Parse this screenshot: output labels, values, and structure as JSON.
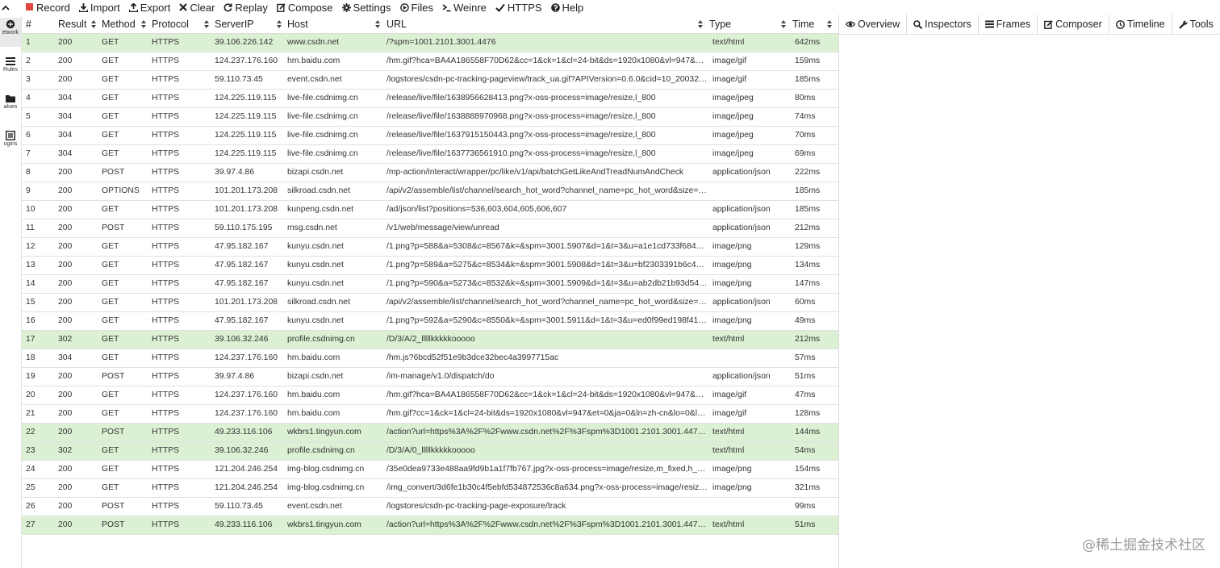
{
  "toolbar": {
    "items": [
      {
        "label": "Record",
        "icon": "record-icon"
      },
      {
        "label": "Import",
        "icon": "import-icon"
      },
      {
        "label": "Export",
        "icon": "export-icon"
      },
      {
        "label": "Clear",
        "icon": "clear-icon"
      },
      {
        "label": "Replay",
        "icon": "replay-icon"
      },
      {
        "label": "Compose",
        "icon": "compose-icon"
      },
      {
        "label": "Settings",
        "icon": "gear-icon"
      },
      {
        "label": "Files",
        "icon": "files-icon"
      },
      {
        "label": "Weinre",
        "icon": "terminal-icon"
      },
      {
        "label": "HTTPS",
        "icon": "check-icon"
      },
      {
        "label": "Help",
        "icon": "help-icon"
      }
    ]
  },
  "rail": {
    "items": [
      {
        "label": "etwork",
        "icon": "network-icon"
      },
      {
        "label": "Rules",
        "icon": "rules-icon"
      },
      {
        "label": "alues",
        "icon": "values-icon"
      },
      {
        "label": "ugins",
        "icon": "plugins-icon"
      }
    ]
  },
  "grid": {
    "columns": {
      "num": "#",
      "result": "Result",
      "method": "Method",
      "protocol": "Protocol",
      "serverip": "ServerIP",
      "host": "Host",
      "url": "URL",
      "type": "Type",
      "time": "Time"
    },
    "rows": [
      {
        "num": "1",
        "result": "200",
        "method": "GET",
        "protocol": "HTTPS",
        "ip": "39.106.226.142",
        "host": "www.csdn.net",
        "url": "/?spm=1001.2101.3001.4476",
        "type": "text/html",
        "time": "642ms",
        "green": true
      },
      {
        "num": "2",
        "result": "200",
        "method": "GET",
        "protocol": "HTTPS",
        "ip": "124.237.176.160",
        "host": "hm.baidu.com",
        "url": "/hm.gif?hca=BA4A186558F70D62&cc=1&ck=1&cl=24-bit&ds=1920x1080&vl=947&ep=9…",
        "type": "image/gif",
        "time": "159ms",
        "green": false
      },
      {
        "num": "3",
        "result": "200",
        "method": "GET",
        "protocol": "HTTPS",
        "ip": "59.110.73.45",
        "host": "event.csdn.net",
        "url": "/logstores/csdn-pc-tracking-pageview/track_ua.gif?APIVersion=0.6.0&cid=10_200327090…",
        "type": "image/gif",
        "time": "185ms",
        "green": false
      },
      {
        "num": "4",
        "result": "304",
        "method": "GET",
        "protocol": "HTTPS",
        "ip": "124.225.119.115",
        "host": "live-file.csdnimg.cn",
        "url": "/release/live/file/1638956628413.png?x-oss-process=image/resize,l_800",
        "type": "image/jpeg",
        "time": "80ms",
        "green": false
      },
      {
        "num": "5",
        "result": "304",
        "method": "GET",
        "protocol": "HTTPS",
        "ip": "124.225.119.115",
        "host": "live-file.csdnimg.cn",
        "url": "/release/live/file/1638888970968.png?x-oss-process=image/resize,l_800",
        "type": "image/jpeg",
        "time": "74ms",
        "green": false
      },
      {
        "num": "6",
        "result": "304",
        "method": "GET",
        "protocol": "HTTPS",
        "ip": "124.225.119.115",
        "host": "live-file.csdnimg.cn",
        "url": "/release/live/file/1637915150443.png?x-oss-process=image/resize,l_800",
        "type": "image/jpeg",
        "time": "70ms",
        "green": false
      },
      {
        "num": "7",
        "result": "304",
        "method": "GET",
        "protocol": "HTTPS",
        "ip": "124.225.119.115",
        "host": "live-file.csdnimg.cn",
        "url": "/release/live/file/1637736561910.png?x-oss-process=image/resize,l_800",
        "type": "image/jpeg",
        "time": "69ms",
        "green": false
      },
      {
        "num": "8",
        "result": "200",
        "method": "POST",
        "protocol": "HTTPS",
        "ip": "39.97.4.86",
        "host": "bizapi.csdn.net",
        "url": "/mp-action/interact/wrapper/pc/like/v1/api/batchGetLikeAndTreadNumAndCheck",
        "type": "application/json",
        "time": "222ms",
        "green": false
      },
      {
        "num": "9",
        "result": "200",
        "method": "OPTIONS",
        "protocol": "HTTPS",
        "ip": "101.201.173.208",
        "host": "silkroad.csdn.net",
        "url": "/api/v2/assemble/list/channel/search_hot_word?channel_name=pc_hot_word&size=10&…",
        "type": "",
        "time": "185ms",
        "green": false
      },
      {
        "num": "10",
        "result": "200",
        "method": "GET",
        "protocol": "HTTPS",
        "ip": "101.201.173.208",
        "host": "kunpeng.csdn.net",
        "url": "/ad/json/list?positions=536,603,604,605,606,607",
        "type": "application/json",
        "time": "185ms",
        "green": false
      },
      {
        "num": "11",
        "result": "200",
        "method": "POST",
        "protocol": "HTTPS",
        "ip": "59.110.175.195",
        "host": "msg.csdn.net",
        "url": "/v1/web/message/view/unread",
        "type": "application/json",
        "time": "212ms",
        "green": false
      },
      {
        "num": "12",
        "result": "200",
        "method": "GET",
        "protocol": "HTTPS",
        "ip": "47.95.182.167",
        "host": "kunyu.csdn.net",
        "url": "/1.png?p=588&a=5308&c=8567&k=&spm=3001.5907&d=1&t=3&u=a1e1cd733f684421a…",
        "type": "image/png",
        "time": "129ms",
        "green": false
      },
      {
        "num": "13",
        "result": "200",
        "method": "GET",
        "protocol": "HTTPS",
        "ip": "47.95.182.167",
        "host": "kunyu.csdn.net",
        "url": "/1.png?p=589&a=5275&c=8534&k=&spm=3001.5908&d=1&t=3&u=bf2303391b6c4a648f…",
        "type": "image/png",
        "time": "134ms",
        "green": false
      },
      {
        "num": "14",
        "result": "200",
        "method": "GET",
        "protocol": "HTTPS",
        "ip": "47.95.182.167",
        "host": "kunyu.csdn.net",
        "url": "/1.png?p=590&a=5273&c=8532&k=&spm=3001.5909&d=1&t=3&u=ab2db21b93d549aeb…",
        "type": "image/png",
        "time": "147ms",
        "green": false
      },
      {
        "num": "15",
        "result": "200",
        "method": "GET",
        "protocol": "HTTPS",
        "ip": "101.201.173.208",
        "host": "silkroad.csdn.net",
        "url": "/api/v2/assemble/list/channel/search_hot_word?channel_name=pc_hot_word&size=10&…",
        "type": "application/json",
        "time": "60ms",
        "green": false
      },
      {
        "num": "16",
        "result": "200",
        "method": "GET",
        "protocol": "HTTPS",
        "ip": "47.95.182.167",
        "host": "kunyu.csdn.net",
        "url": "/1.png?p=592&a=5290&c=8550&k=&spm=3001.5911&d=1&t=3&u=ed0f99ed198f412f87…",
        "type": "image/png",
        "time": "49ms",
        "green": false
      },
      {
        "num": "17",
        "result": "302",
        "method": "GET",
        "protocol": "HTTPS",
        "ip": "39.106.32.246",
        "host": "profile.csdnimg.cn",
        "url": "/D/3/A/2_lllllkkkkkooooo",
        "type": "text/html",
        "time": "212ms",
        "green": true
      },
      {
        "num": "18",
        "result": "304",
        "method": "GET",
        "protocol": "HTTPS",
        "ip": "124.237.176.160",
        "host": "hm.baidu.com",
        "url": "/hm.js?6bcd52f51e9b3dce32bec4a3997715ac",
        "type": "",
        "time": "57ms",
        "green": false
      },
      {
        "num": "19",
        "result": "200",
        "method": "POST",
        "protocol": "HTTPS",
        "ip": "39.97.4.86",
        "host": "bizapi.csdn.net",
        "url": "/im-manage/v1.0/dispatch/do",
        "type": "application/json",
        "time": "51ms",
        "green": false
      },
      {
        "num": "20",
        "result": "200",
        "method": "GET",
        "protocol": "HTTPS",
        "ip": "124.237.176.160",
        "host": "hm.baidu.com",
        "url": "/hm.gif?hca=BA4A186558F70D62&cc=1&ck=1&cl=24-bit&ds=1920x1080&vl=947&ep=9…",
        "type": "image/gif",
        "time": "47ms",
        "green": false
      },
      {
        "num": "21",
        "result": "200",
        "method": "GET",
        "protocol": "HTTPS",
        "ip": "124.237.176.160",
        "host": "hm.baidu.com",
        "url": "/hm.gif?cc=1&ck=1&cl=24-bit&ds=1920x1080&vl=947&et=0&ja=0&ln=zh-cn&lo=0&lt=16…",
        "type": "image/gif",
        "time": "128ms",
        "green": false
      },
      {
        "num": "22",
        "result": "200",
        "method": "POST",
        "protocol": "HTTPS",
        "ip": "49.233.116.106",
        "host": "wkbrs1.tingyun.com",
        "url": "/action?url=https%3A%2F%2Fwww.csdn.net%2F%3Fspm%3D1001.2101.3001.4476&pv…",
        "type": "text/html",
        "time": "144ms",
        "green": true
      },
      {
        "num": "23",
        "result": "302",
        "method": "GET",
        "protocol": "HTTPS",
        "ip": "39.106.32.246",
        "host": "profile.csdnimg.cn",
        "url": "/D/3/A/0_lllllkkkkkooooo",
        "type": "text/html",
        "time": "54ms",
        "green": true
      },
      {
        "num": "24",
        "result": "200",
        "method": "GET",
        "protocol": "HTTPS",
        "ip": "121.204.246.254",
        "host": "img-blog.csdnimg.cn",
        "url": "/35e0dea9733e488aa9fd9b1a1f7fb767.jpg?x-oss-process=image/resize,m_fixed,h_300,i…",
        "type": "image/png",
        "time": "154ms",
        "green": false
      },
      {
        "num": "25",
        "result": "200",
        "method": "GET",
        "protocol": "HTTPS",
        "ip": "121.204.246.254",
        "host": "img-blog.csdnimg.cn",
        "url": "/img_convert/3d6fe1b30c4f5ebfd534872536c8a634.png?x-oss-process=image/resize,m_…",
        "type": "image/png",
        "time": "321ms",
        "green": false
      },
      {
        "num": "26",
        "result": "200",
        "method": "POST",
        "protocol": "HTTPS",
        "ip": "59.110.73.45",
        "host": "event.csdn.net",
        "url": "/logstores/csdn-pc-tracking-page-exposure/track",
        "type": "",
        "time": "99ms",
        "green": false
      },
      {
        "num": "27",
        "result": "200",
        "method": "POST",
        "protocol": "HTTPS",
        "ip": "49.233.116.106",
        "host": "wkbrs1.tingyun.com",
        "url": "/action?url=https%3A%2F%2Fwww.csdn.net%2F%3Fspm%3D1001.2101.3001.4476&pv…",
        "type": "text/html",
        "time": "51ms",
        "green": true
      }
    ]
  },
  "panel": {
    "tabs": [
      {
        "label": "Overview",
        "icon": "eye-icon"
      },
      {
        "label": "Inspectors",
        "icon": "search-icon"
      },
      {
        "label": "Frames",
        "icon": "list-icon"
      },
      {
        "label": "Composer",
        "icon": "edit-icon"
      },
      {
        "label": "Timeline",
        "icon": "clock-icon"
      },
      {
        "label": "Tools",
        "icon": "wrench-icon"
      }
    ]
  },
  "watermark": "@稀土掘金技术社区",
  "colors": {
    "row_highlight": "#dcf0d3",
    "record_red": "#e0473d"
  }
}
